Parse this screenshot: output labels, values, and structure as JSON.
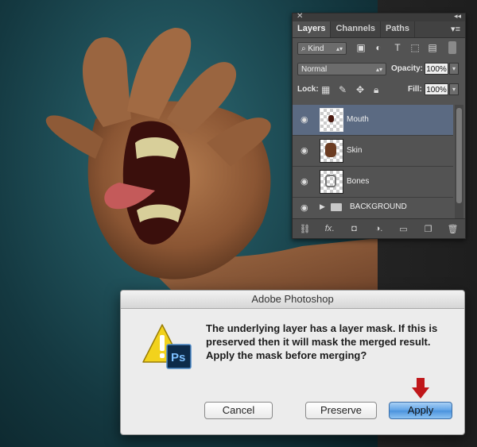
{
  "panel": {
    "tabs": [
      "Layers",
      "Channels",
      "Paths"
    ],
    "kind_label": "Kind",
    "blend_mode": "Normal",
    "opacity_label": "Opacity:",
    "opacity_value": "100%",
    "lock_label": "Lock:",
    "fill_label": "Fill:",
    "fill_value": "100%",
    "layers": [
      {
        "name": "Mouth",
        "selected": true
      },
      {
        "name": "Skin",
        "selected": false
      },
      {
        "name": "Bones",
        "selected": false
      }
    ],
    "group_name": "BACKGROUND"
  },
  "dialog": {
    "title": "Adobe Photoshop",
    "message": "The underlying layer has a layer mask. If this is preserved then it will mask the merged result. Apply the mask before merging?",
    "icon_badge": "Ps",
    "cancel_label": "Cancel",
    "preserve_label": "Preserve",
    "apply_label": "Apply"
  },
  "colors": {
    "selected_layer": "#5b6a82",
    "primary_button": "#4a92dd",
    "arrow": "#c0171a"
  }
}
